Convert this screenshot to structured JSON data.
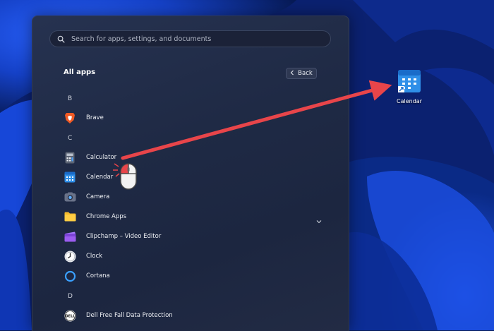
{
  "search": {
    "placeholder": "Search for apps, settings, and documents"
  },
  "all_apps": {
    "title": "All apps",
    "back_label": "Back"
  },
  "sections": {
    "b": "B",
    "c": "C",
    "d": "D"
  },
  "apps": {
    "brave": "Brave",
    "calculator": "Calculator",
    "calendar": "Calendar",
    "camera": "Camera",
    "chrome_apps": "Chrome Apps",
    "clipchamp": "Clipchamp – Video Editor",
    "clock": "Clock",
    "cortana": "Cortana",
    "dell": "Dell Free Fall Data Protection"
  },
  "desktop": {
    "calendar_label": "Calendar"
  },
  "icons": {
    "search": "search-icon",
    "back": "chevron-left-icon",
    "expand": "chevron-down-icon",
    "mouse": "mouse-icon",
    "arrow": "arrow-icon"
  },
  "colors": {
    "arrow": "#e8454a",
    "menu_bg": "#202a44",
    "accent": "#2f8fe8"
  }
}
